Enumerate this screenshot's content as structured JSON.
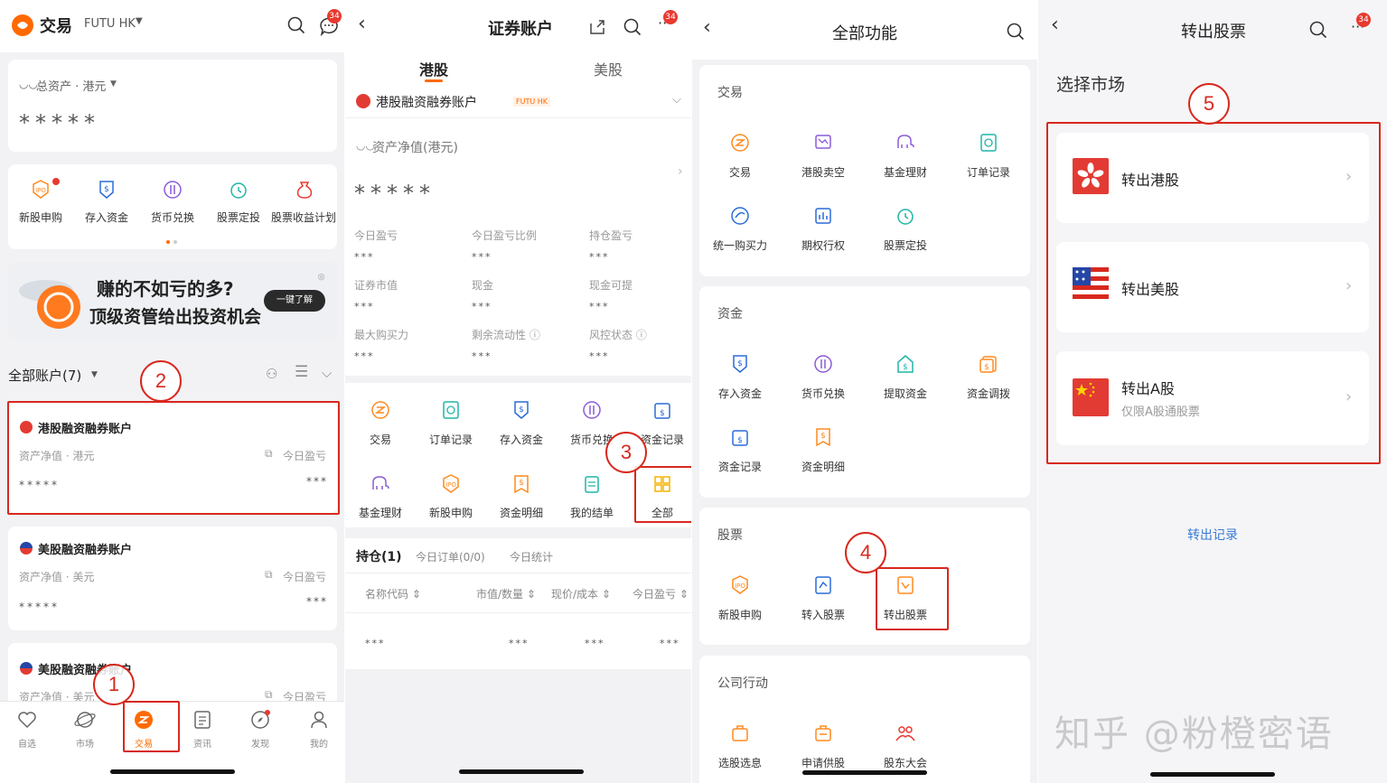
{
  "p1": {
    "title": "交易",
    "broker": "FUTU HK",
    "badge": "34",
    "total_assets_label": "总资产 · 港元",
    "total_assets_value": "*****",
    "quick": [
      "新股申购",
      "存入资金",
      "货币兑换",
      "股票定投",
      "股票收益计划"
    ],
    "banner_line1": "赚的不如亏的多?",
    "banner_line2": "顶级资管给出投资机会",
    "banner_btn": "一键了解",
    "accounts_label": "全部账户(7)",
    "acc1_name": "港股融资融券账户",
    "acc1_nav": "资产净值 · 港元",
    "acc1_pl": "今日盈亏",
    "acc1_value": "*****",
    "acc1_pl_value": "***",
    "acc2_name": "美股融资融券账户",
    "acc2_nav": "资产净值 · 美元",
    "acc2_pl": "今日盈亏",
    "acc2_value": "*****",
    "acc2_pl_value": "***",
    "acc3_name": "美股融资融券账户",
    "acc3_nav": "资产净值 · 美元",
    "acc3_pl": "今日盈亏",
    "nav": [
      "自选",
      "市场",
      "交易",
      "资讯",
      "发现",
      "我的"
    ],
    "step1": "1",
    "step2": "2"
  },
  "p2": {
    "title": "证券账户",
    "badge": "34",
    "tab_hk": "港股",
    "tab_us": "美股",
    "account": "港股融资融券账户",
    "futu_tag": "FUTU HK",
    "nav_label": "资产净值(港元)",
    "nav_value": "*****",
    "metrics": [
      {
        "label": "今日盈亏",
        "value": "***"
      },
      {
        "label": "今日盈亏比例",
        "value": "***"
      },
      {
        "label": "持仓盈亏",
        "value": "***"
      },
      {
        "label": "证券市值",
        "value": "***"
      },
      {
        "label": "现金",
        "value": "***"
      },
      {
        "label": "现金可提",
        "value": "***"
      },
      {
        "label": "最大购买力",
        "value": "***"
      },
      {
        "label": "剩余流动性 ⓘ",
        "value": "***"
      },
      {
        "label": "风控状态 ⓘ",
        "value": "***"
      }
    ],
    "funcs_row1": [
      "交易",
      "订单记录",
      "存入资金",
      "货币兑换",
      "资金记录"
    ],
    "funcs_row2": [
      "基金理财",
      "新股申购",
      "资金明细",
      "我的结单",
      "全部"
    ],
    "pos_tabs": [
      "持仓(1)",
      "今日订单(0/0)",
      "今日统计"
    ],
    "cols": [
      "名称代码 ⇕",
      "市值/数量 ⇕",
      "现价/成本 ⇕",
      "今日盈亏 ⇕"
    ],
    "row": [
      "***",
      "***",
      "***",
      "***"
    ],
    "step3": "3"
  },
  "p3": {
    "title": "全部功能",
    "sec_trade": "交易",
    "trade_items": [
      "交易",
      "港股卖空",
      "基金理财",
      "订单记录",
      "统一购买力",
      "期权行权",
      "股票定投"
    ],
    "sec_funds": "资金",
    "fund_items": [
      "存入资金",
      "货币兑换",
      "提取资金",
      "资金调拨",
      "资金记录",
      "资金明细"
    ],
    "sec_stock": "股票",
    "stock_items": [
      "新股申购",
      "转入股票",
      "转出股票"
    ],
    "sec_corp": "公司行动",
    "corp_items": [
      "选股选息",
      "申请供股",
      "股东大会"
    ],
    "step4": "4"
  },
  "p4": {
    "title": "转出股票",
    "badge": "34",
    "select_market": "选择市场",
    "hk": "转出港股",
    "us": "转出美股",
    "cn": "转出A股",
    "cn_sub": "仅限A股通股票",
    "records": "转出记录",
    "watermark": "知乎 @粉橙密语",
    "step5": "5"
  },
  "colors": {
    "accent": "#ff6a00",
    "annotation_red": "#d8281e",
    "link_blue": "#3a7bd5"
  }
}
